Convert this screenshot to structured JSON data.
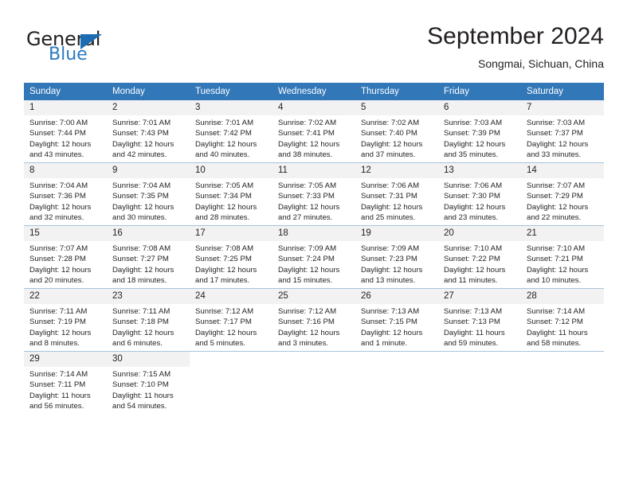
{
  "brand": {
    "word_one": "General",
    "word_two": "Blue",
    "triangle_icon": "triangle-logo-icon"
  },
  "header": {
    "month_title": "September 2024",
    "location": "Songmai, Sichuan, China"
  },
  "colors": {
    "header_blue": "#3277b8",
    "brand_blue": "#2a7ac0",
    "daynum_bg": "#f2f2f2",
    "row_border": "#a8c4dd",
    "text": "#231f20"
  },
  "weekday_headers": [
    "Sunday",
    "Monday",
    "Tuesday",
    "Wednesday",
    "Thursday",
    "Friday",
    "Saturday"
  ],
  "weeks": [
    [
      {
        "day": "1",
        "sunrise": "Sunrise: 7:00 AM",
        "sunset": "Sunset: 7:44 PM",
        "daylight_1": "Daylight: 12 hours",
        "daylight_2": "and 43 minutes."
      },
      {
        "day": "2",
        "sunrise": "Sunrise: 7:01 AM",
        "sunset": "Sunset: 7:43 PM",
        "daylight_1": "Daylight: 12 hours",
        "daylight_2": "and 42 minutes."
      },
      {
        "day": "3",
        "sunrise": "Sunrise: 7:01 AM",
        "sunset": "Sunset: 7:42 PM",
        "daylight_1": "Daylight: 12 hours",
        "daylight_2": "and 40 minutes."
      },
      {
        "day": "4",
        "sunrise": "Sunrise: 7:02 AM",
        "sunset": "Sunset: 7:41 PM",
        "daylight_1": "Daylight: 12 hours",
        "daylight_2": "and 38 minutes."
      },
      {
        "day": "5",
        "sunrise": "Sunrise: 7:02 AM",
        "sunset": "Sunset: 7:40 PM",
        "daylight_1": "Daylight: 12 hours",
        "daylight_2": "and 37 minutes."
      },
      {
        "day": "6",
        "sunrise": "Sunrise: 7:03 AM",
        "sunset": "Sunset: 7:39 PM",
        "daylight_1": "Daylight: 12 hours",
        "daylight_2": "and 35 minutes."
      },
      {
        "day": "7",
        "sunrise": "Sunrise: 7:03 AM",
        "sunset": "Sunset: 7:37 PM",
        "daylight_1": "Daylight: 12 hours",
        "daylight_2": "and 33 minutes."
      }
    ],
    [
      {
        "day": "8",
        "sunrise": "Sunrise: 7:04 AM",
        "sunset": "Sunset: 7:36 PM",
        "daylight_1": "Daylight: 12 hours",
        "daylight_2": "and 32 minutes."
      },
      {
        "day": "9",
        "sunrise": "Sunrise: 7:04 AM",
        "sunset": "Sunset: 7:35 PM",
        "daylight_1": "Daylight: 12 hours",
        "daylight_2": "and 30 minutes."
      },
      {
        "day": "10",
        "sunrise": "Sunrise: 7:05 AM",
        "sunset": "Sunset: 7:34 PM",
        "daylight_1": "Daylight: 12 hours",
        "daylight_2": "and 28 minutes."
      },
      {
        "day": "11",
        "sunrise": "Sunrise: 7:05 AM",
        "sunset": "Sunset: 7:33 PM",
        "daylight_1": "Daylight: 12 hours",
        "daylight_2": "and 27 minutes."
      },
      {
        "day": "12",
        "sunrise": "Sunrise: 7:06 AM",
        "sunset": "Sunset: 7:31 PM",
        "daylight_1": "Daylight: 12 hours",
        "daylight_2": "and 25 minutes."
      },
      {
        "day": "13",
        "sunrise": "Sunrise: 7:06 AM",
        "sunset": "Sunset: 7:30 PM",
        "daylight_1": "Daylight: 12 hours",
        "daylight_2": "and 23 minutes."
      },
      {
        "day": "14",
        "sunrise": "Sunrise: 7:07 AM",
        "sunset": "Sunset: 7:29 PM",
        "daylight_1": "Daylight: 12 hours",
        "daylight_2": "and 22 minutes."
      }
    ],
    [
      {
        "day": "15",
        "sunrise": "Sunrise: 7:07 AM",
        "sunset": "Sunset: 7:28 PM",
        "daylight_1": "Daylight: 12 hours",
        "daylight_2": "and 20 minutes."
      },
      {
        "day": "16",
        "sunrise": "Sunrise: 7:08 AM",
        "sunset": "Sunset: 7:27 PM",
        "daylight_1": "Daylight: 12 hours",
        "daylight_2": "and 18 minutes."
      },
      {
        "day": "17",
        "sunrise": "Sunrise: 7:08 AM",
        "sunset": "Sunset: 7:25 PM",
        "daylight_1": "Daylight: 12 hours",
        "daylight_2": "and 17 minutes."
      },
      {
        "day": "18",
        "sunrise": "Sunrise: 7:09 AM",
        "sunset": "Sunset: 7:24 PM",
        "daylight_1": "Daylight: 12 hours",
        "daylight_2": "and 15 minutes."
      },
      {
        "day": "19",
        "sunrise": "Sunrise: 7:09 AM",
        "sunset": "Sunset: 7:23 PM",
        "daylight_1": "Daylight: 12 hours",
        "daylight_2": "and 13 minutes."
      },
      {
        "day": "20",
        "sunrise": "Sunrise: 7:10 AM",
        "sunset": "Sunset: 7:22 PM",
        "daylight_1": "Daylight: 12 hours",
        "daylight_2": "and 11 minutes."
      },
      {
        "day": "21",
        "sunrise": "Sunrise: 7:10 AM",
        "sunset": "Sunset: 7:21 PM",
        "daylight_1": "Daylight: 12 hours",
        "daylight_2": "and 10 minutes."
      }
    ],
    [
      {
        "day": "22",
        "sunrise": "Sunrise: 7:11 AM",
        "sunset": "Sunset: 7:19 PM",
        "daylight_1": "Daylight: 12 hours",
        "daylight_2": "and 8 minutes."
      },
      {
        "day": "23",
        "sunrise": "Sunrise: 7:11 AM",
        "sunset": "Sunset: 7:18 PM",
        "daylight_1": "Daylight: 12 hours",
        "daylight_2": "and 6 minutes."
      },
      {
        "day": "24",
        "sunrise": "Sunrise: 7:12 AM",
        "sunset": "Sunset: 7:17 PM",
        "daylight_1": "Daylight: 12 hours",
        "daylight_2": "and 5 minutes."
      },
      {
        "day": "25",
        "sunrise": "Sunrise: 7:12 AM",
        "sunset": "Sunset: 7:16 PM",
        "daylight_1": "Daylight: 12 hours",
        "daylight_2": "and 3 minutes."
      },
      {
        "day": "26",
        "sunrise": "Sunrise: 7:13 AM",
        "sunset": "Sunset: 7:15 PM",
        "daylight_1": "Daylight: 12 hours",
        "daylight_2": "and 1 minute."
      },
      {
        "day": "27",
        "sunrise": "Sunrise: 7:13 AM",
        "sunset": "Sunset: 7:13 PM",
        "daylight_1": "Daylight: 11 hours",
        "daylight_2": "and 59 minutes."
      },
      {
        "day": "28",
        "sunrise": "Sunrise: 7:14 AM",
        "sunset": "Sunset: 7:12 PM",
        "daylight_1": "Daylight: 11 hours",
        "daylight_2": "and 58 minutes."
      }
    ],
    [
      {
        "day": "29",
        "sunrise": "Sunrise: 7:14 AM",
        "sunset": "Sunset: 7:11 PM",
        "daylight_1": "Daylight: 11 hours",
        "daylight_2": "and 56 minutes."
      },
      {
        "day": "30",
        "sunrise": "Sunrise: 7:15 AM",
        "sunset": "Sunset: 7:10 PM",
        "daylight_1": "Daylight: 11 hours",
        "daylight_2": "and 54 minutes."
      },
      {
        "day": "",
        "sunrise": "",
        "sunset": "",
        "daylight_1": "",
        "daylight_2": ""
      },
      {
        "day": "",
        "sunrise": "",
        "sunset": "",
        "daylight_1": "",
        "daylight_2": ""
      },
      {
        "day": "",
        "sunrise": "",
        "sunset": "",
        "daylight_1": "",
        "daylight_2": ""
      },
      {
        "day": "",
        "sunrise": "",
        "sunset": "",
        "daylight_1": "",
        "daylight_2": ""
      },
      {
        "day": "",
        "sunrise": "",
        "sunset": "",
        "daylight_1": "",
        "daylight_2": ""
      }
    ]
  ]
}
